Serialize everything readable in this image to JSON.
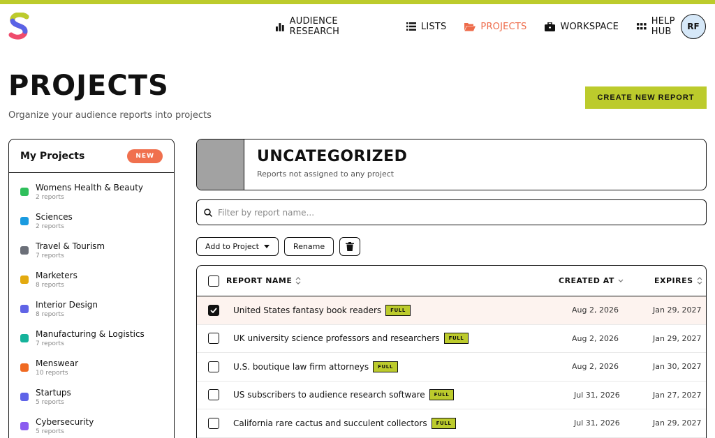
{
  "nav": {
    "items": [
      {
        "label": "AUDIENCE RESEARCH",
        "icon": "bar-chart-icon"
      },
      {
        "label": "LISTS",
        "icon": "list-icon"
      },
      {
        "label": "PROJECTS",
        "icon": "folder-open-icon"
      },
      {
        "label": "WORKSPACE",
        "icon": "briefcase-icon"
      },
      {
        "label": "HELP HUB",
        "icon": "grid-dots-icon"
      }
    ],
    "active": "PROJECTS",
    "avatar": "RF"
  },
  "header": {
    "title": "PROJECTS",
    "subtitle": "Organize your audience reports into projects",
    "create_label": "CREATE NEW REPORT"
  },
  "sidebar": {
    "title": "My Projects",
    "badge": "NEW",
    "items": [
      {
        "name": "Womens Health & Beauty",
        "count": "2 reports",
        "color": "#2fbf5b"
      },
      {
        "name": "Sciences",
        "count": "2 reports",
        "color": "#1a9be0"
      },
      {
        "name": "Travel & Tourism",
        "count": "7 reports",
        "color": "#6b6f78"
      },
      {
        "name": "Marketers",
        "count": "8 reports",
        "color": "#e3aa10"
      },
      {
        "name": "Interior Design",
        "count": "8 reports",
        "color": "#6064e6"
      },
      {
        "name": "Manufacturing & Logistics",
        "count": "7 reports",
        "color": "#15b39b"
      },
      {
        "name": "Menswear",
        "count": "10 reports",
        "color": "#f06a22"
      },
      {
        "name": "Startups",
        "count": "5 reports",
        "color": "#5e63e8"
      },
      {
        "name": "Cybersecurity",
        "count": "5 reports",
        "color": "#8b5cf0"
      }
    ]
  },
  "category": {
    "title": "UNCATEGORIZED",
    "subtitle": "Reports not assigned to any project",
    "color": "#a2a2a2"
  },
  "filter": {
    "placeholder": "Filter by report name..."
  },
  "actions": {
    "add_label": "Add to Project",
    "rename_label": "Rename"
  },
  "table": {
    "headers": {
      "name": "REPORT NAME",
      "created": "CREATED AT",
      "expires": "EXPIRES"
    },
    "rows": [
      {
        "name": "United States fantasy book readers",
        "badge": "FULL",
        "created": "Aug 2, 2026",
        "expires": "Jan 29, 2027",
        "checked": true
      },
      {
        "name": "UK university science professors and researchers",
        "badge": "FULL",
        "created": "Aug 2, 2026",
        "expires": "Jan 29, 2027",
        "checked": false
      },
      {
        "name": "U.S. boutique law firm attorneys",
        "badge": "FULL",
        "created": "Aug 2, 2026",
        "expires": "Jan 30, 2027",
        "checked": false
      },
      {
        "name": "US subscribers to audience research software",
        "badge": "FULL",
        "created": "Jul 31, 2026",
        "expires": "Jan 27, 2027",
        "checked": false
      },
      {
        "name": "California rare cactus and succulent collectors",
        "badge": "FULL",
        "created": "Jul 31, 2026",
        "expires": "Jan 29, 2027",
        "checked": false
      }
    ]
  },
  "colors": {
    "accent": "#bccb2c",
    "active_nav": "#ee6b4a",
    "badge_new": "#f0704e"
  }
}
